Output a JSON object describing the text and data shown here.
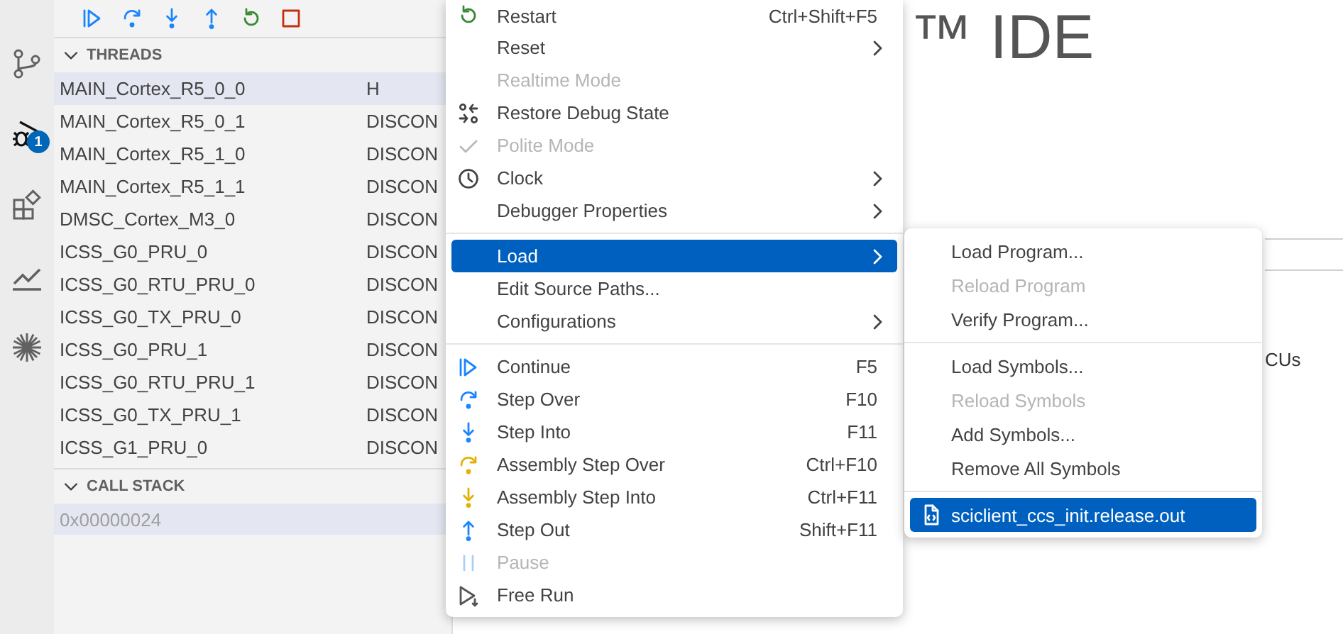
{
  "activity_bar": {
    "debug_badge": "1"
  },
  "sidebar": {
    "threads": {
      "title": "THREADS",
      "expanded": true,
      "rows": [
        {
          "name": "MAIN_Cortex_R5_0_0",
          "status": "H",
          "selected": true
        },
        {
          "name": "MAIN_Cortex_R5_0_1",
          "status": "DISCON",
          "selected": false
        },
        {
          "name": "MAIN_Cortex_R5_1_0",
          "status": "DISCON",
          "selected": false
        },
        {
          "name": "MAIN_Cortex_R5_1_1",
          "status": "DISCON",
          "selected": false
        },
        {
          "name": "DMSC_Cortex_M3_0",
          "status": "DISCON",
          "selected": false
        },
        {
          "name": "ICSS_G0_PRU_0",
          "status": "DISCON",
          "selected": false
        },
        {
          "name": "ICSS_G0_RTU_PRU_0",
          "status": "DISCON",
          "selected": false
        },
        {
          "name": "ICSS_G0_TX_PRU_0",
          "status": "DISCON",
          "selected": false
        },
        {
          "name": "ICSS_G0_PRU_1",
          "status": "DISCON",
          "selected": false
        },
        {
          "name": "ICSS_G0_RTU_PRU_1",
          "status": "DISCON",
          "selected": false
        },
        {
          "name": "ICSS_G0_TX_PRU_1",
          "status": "DISCON",
          "selected": false
        },
        {
          "name": "ICSS_G1_PRU_0",
          "status": "DISCON",
          "selected": false
        }
      ]
    },
    "call_stack": {
      "title": "CALL STACK",
      "expanded": true,
      "frames": [
        {
          "address": "0x00000024",
          "selected": true
        }
      ]
    }
  },
  "editor": {
    "heading": "™ IDE",
    "text": "CUs"
  },
  "context_menu": {
    "groups": [
      {
        "items": [
          {
            "label": "Restart",
            "shortcut": "Ctrl+Shift+F5",
            "kind": "restart",
            "disabled": false,
            "selected": false,
            "checked": false,
            "submenu": false
          },
          {
            "label": "Reset",
            "kind": "plain",
            "disabled": false,
            "selected": false,
            "checked": false,
            "submenu": true
          },
          {
            "label": "Realtime Mode",
            "kind": "plain",
            "disabled": true,
            "selected": false,
            "checked": false,
            "submenu": false
          },
          {
            "label": "Restore Debug State",
            "kind": "restore",
            "disabled": false,
            "selected": false,
            "checked": false,
            "submenu": false
          },
          {
            "label": "Polite Mode",
            "kind": "plain",
            "disabled": true,
            "selected": false,
            "checked": true,
            "submenu": false
          },
          {
            "label": "Clock",
            "kind": "clock",
            "disabled": false,
            "selected": false,
            "checked": false,
            "submenu": true
          },
          {
            "label": "Debugger Properties",
            "kind": "plain",
            "disabled": false,
            "selected": false,
            "checked": false,
            "submenu": true
          }
        ]
      },
      {
        "items": [
          {
            "label": "Load",
            "kind": "plain",
            "disabled": false,
            "selected": true,
            "checked": false,
            "submenu": true
          },
          {
            "label": "Edit Source Paths...",
            "kind": "plain",
            "disabled": false,
            "selected": false,
            "checked": false,
            "submenu": false
          },
          {
            "label": "Configurations",
            "kind": "plain",
            "disabled": false,
            "selected": false,
            "checked": false,
            "submenu": true
          }
        ]
      },
      {
        "items": [
          {
            "label": "Continue",
            "shortcut": "F5",
            "kind": "continue",
            "disabled": false,
            "selected": false,
            "checked": false,
            "submenu": false
          },
          {
            "label": "Step Over",
            "shortcut": "F10",
            "kind": "stepover",
            "disabled": false,
            "selected": false,
            "checked": false,
            "submenu": false
          },
          {
            "label": "Step Into",
            "shortcut": "F11",
            "kind": "stepinto",
            "disabled": false,
            "selected": false,
            "checked": false,
            "submenu": false
          },
          {
            "label": "Assembly Step Over",
            "shortcut": "Ctrl+F10",
            "kind": "asmstepover",
            "disabled": false,
            "selected": false,
            "checked": false,
            "submenu": false
          },
          {
            "label": "Assembly Step Into",
            "shortcut": "Ctrl+F11",
            "kind": "asmstepinto",
            "disabled": false,
            "selected": false,
            "checked": false,
            "submenu": false
          },
          {
            "label": "Step Out",
            "shortcut": "Shift+F11",
            "kind": "stepout",
            "disabled": false,
            "selected": false,
            "checked": false,
            "submenu": false
          },
          {
            "label": "Pause",
            "kind": "pause",
            "disabled": true,
            "selected": false,
            "checked": false,
            "submenu": false
          },
          {
            "label": "Free Run",
            "kind": "freerun",
            "disabled": false,
            "selected": false,
            "checked": false,
            "submenu": false
          }
        ]
      }
    ]
  },
  "submenu": {
    "groups": [
      {
        "items": [
          {
            "label": "Load Program...",
            "kind": "plain",
            "disabled": false,
            "selected": false
          },
          {
            "label": "Reload Program",
            "kind": "plain",
            "disabled": true,
            "selected": false
          },
          {
            "label": "Verify Program...",
            "kind": "plain",
            "disabled": false,
            "selected": false
          }
        ]
      },
      {
        "items": [
          {
            "label": "Load Symbols...",
            "kind": "plain",
            "disabled": false,
            "selected": false
          },
          {
            "label": "Reload Symbols",
            "kind": "plain",
            "disabled": true,
            "selected": false
          },
          {
            "label": "Add Symbols...",
            "kind": "plain",
            "disabled": false,
            "selected": false
          },
          {
            "label": "Remove All Symbols",
            "kind": "plain",
            "disabled": false,
            "selected": false
          }
        ]
      },
      {
        "items": [
          {
            "label": "sciclient_ccs_init.release.out",
            "kind": "file",
            "disabled": false,
            "selected": true
          }
        ]
      }
    ]
  }
}
